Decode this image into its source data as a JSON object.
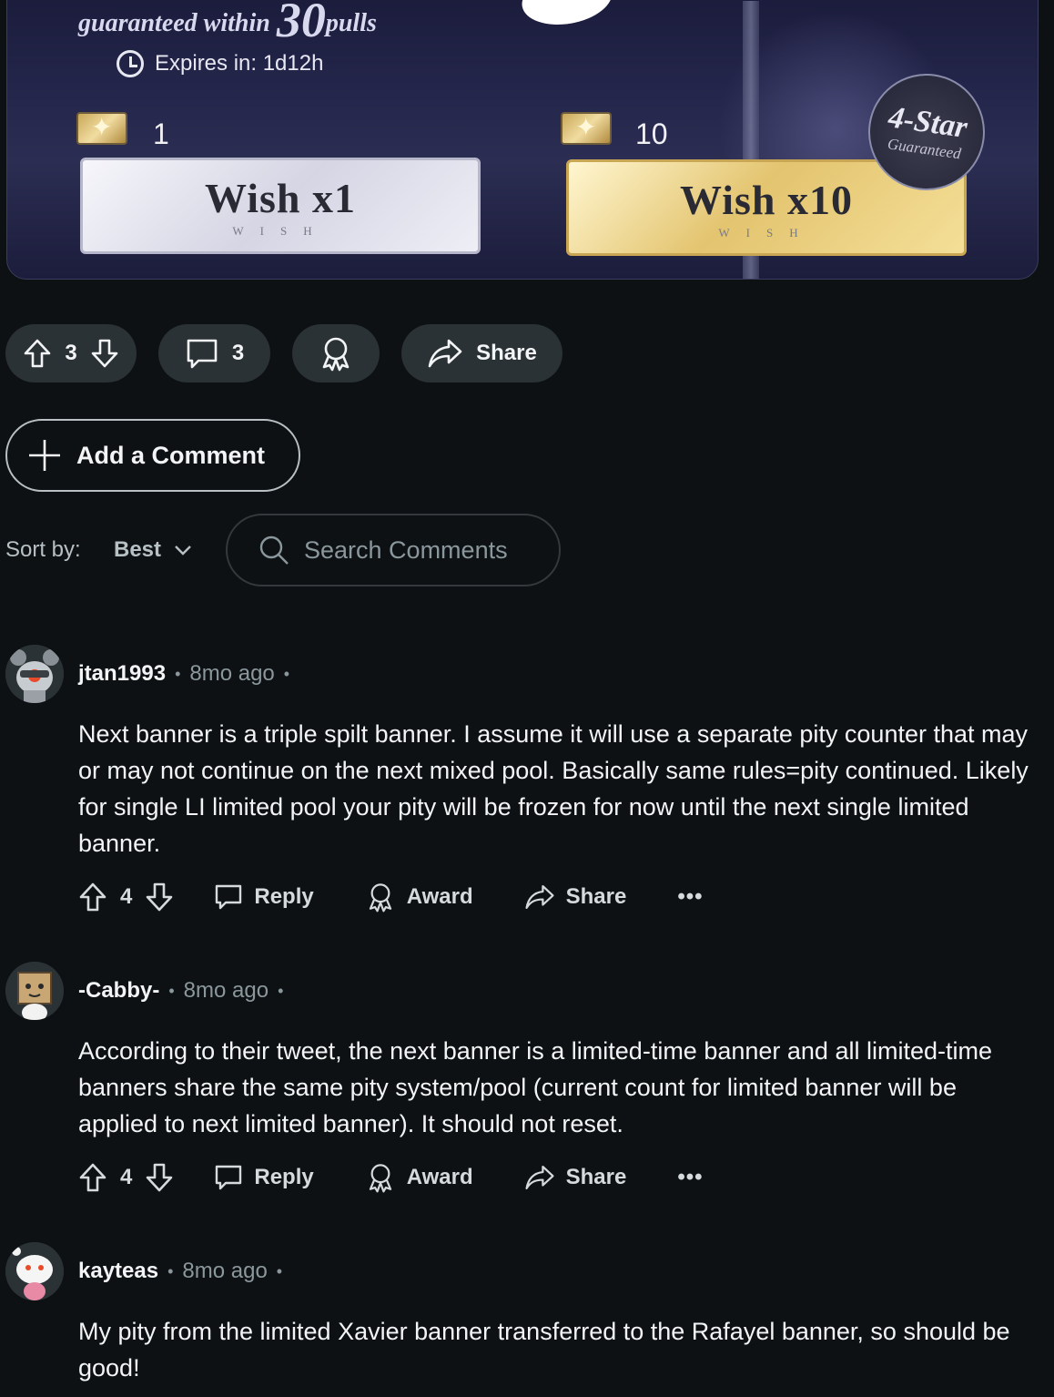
{
  "banner": {
    "guarantee_text": "guaranteed within",
    "guarantee_number": "30",
    "guarantee_unit": "pulls",
    "expires": "Expires in: 1d12h",
    "single_count": "1",
    "multi_count": "10",
    "single_label": "Wish x1",
    "multi_label": "Wish x10",
    "wish_sub": "WISH",
    "badge_title": "4-Star",
    "badge_sub": "Guaranteed"
  },
  "post_actions": {
    "vote_count": "3",
    "comment_count": "3",
    "share_label": "Share"
  },
  "add_comment_label": "Add a Comment",
  "sort": {
    "label": "Sort by:",
    "value": "Best"
  },
  "search": {
    "placeholder": "Search Comments"
  },
  "comments": [
    {
      "author": "jtan1993",
      "time": "8mo ago",
      "body": "Next banner is a triple spilt banner. I assume it will use a separate pity counter that may or may not continue on the next mixed pool. Basically same rules=pity continued. Likely for single LI limited pool your pity will be frozen for now until the next single limited banner.",
      "votes": "4",
      "reply_label": "Reply",
      "award_label": "Award",
      "share_label": "Share",
      "more_label": "•••"
    },
    {
      "author": "-Cabby-",
      "time": "8mo ago",
      "body": "According to their tweet, the next banner is a limited-time banner and all limited-time banners share the same pity system/pool (current count for limited banner will be applied to next limited banner). It should not reset.",
      "votes": "4",
      "reply_label": "Reply",
      "award_label": "Award",
      "share_label": "Share",
      "more_label": "•••"
    },
    {
      "author": "kayteas",
      "time": "8mo ago",
      "body": "My pity from the limited Xavier banner transferred to the Rafayel banner, so should be good!"
    }
  ],
  "colors": {
    "background": "#0e1113",
    "pill": "#2a3236",
    "muted_text": "#8a979c"
  }
}
